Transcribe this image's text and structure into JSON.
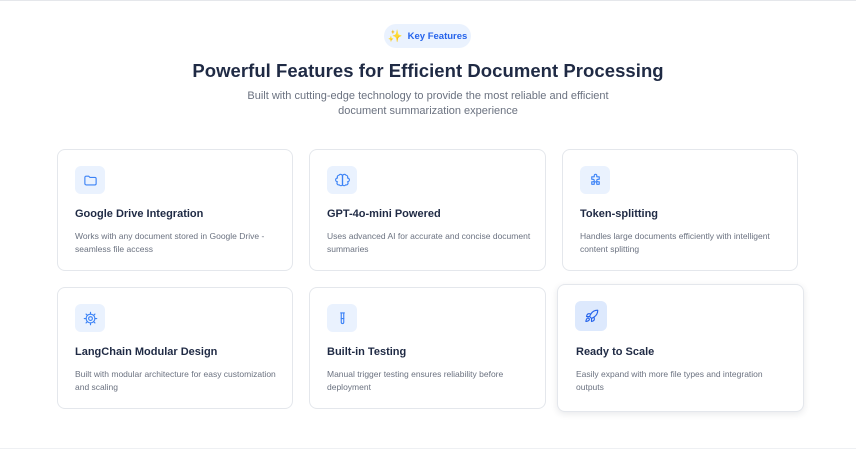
{
  "header": {
    "badge_label": "Key Features",
    "title": "Powerful Features for Efficient Document Processing",
    "subtitle": "Built with cutting-edge technology to provide the most reliable and efficient document summarization experience"
  },
  "features": [
    {
      "title": "Google Drive Integration",
      "description": "Works with any document stored in Google Drive - seamless file access",
      "icon": "folder-icon"
    },
    {
      "title": "GPT-4o-mini Powered",
      "description": "Uses advanced AI for accurate and concise document summaries",
      "icon": "brain-icon"
    },
    {
      "title": "Token-splitting",
      "description": "Handles large documents efficiently with intelligent content splitting",
      "icon": "puzzle-icon"
    },
    {
      "title": "LangChain Modular Design",
      "description": "Built with modular architecture for easy customization and scaling",
      "icon": "gear-icon"
    },
    {
      "title": "Built-in Testing",
      "description": "Manual trigger testing ensures reliability before deployment",
      "icon": "test-tube-icon"
    },
    {
      "title": "Ready to Scale",
      "description": "Easily expand with more file types and integration outputs",
      "icon": "rocket-icon"
    }
  ],
  "colors": {
    "accent": "#2563eb",
    "icon_bg": "#eaf2fe",
    "heading": "#1f2a44",
    "muted": "#6b7280",
    "border": "#e4e7ec"
  }
}
